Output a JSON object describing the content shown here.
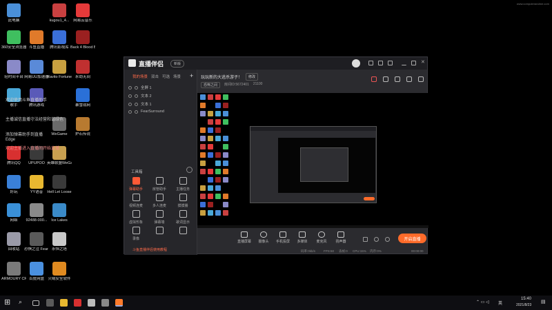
{
  "desktop": {
    "corner_text": "www.computerandme.com",
    "icons": [
      {
        "label": "此电脑",
        "color": "#4a8fd8"
      },
      {
        "label": "kugou1_4...",
        "color": "#c94040"
      },
      {
        "label": "网易云音乐",
        "color": "#e53a3a"
      },
      {
        "label": "360安全浏览器",
        "color": "#3fbf5f"
      },
      {
        "label": "斗鱼直播",
        "color": "#e07a2a"
      },
      {
        "label": "腾讯影视库",
        "color": "#3a6fd8"
      },
      {
        "label": "Back 4 Blood Beta",
        "color": "#9a2020"
      },
      {
        "label": "轻时间平台",
        "color": "#8a8ac8"
      },
      {
        "label": "网易UU加速器",
        "color": "#5a8ad8"
      },
      {
        "label": "Ravito Fortune",
        "color": "#c8a040"
      },
      {
        "label": "永劫无间",
        "color": "#c03030"
      },
      {
        "label": "歌手",
        "color": "#4aa8d8"
      },
      {
        "label": "腾讯游戏",
        "color": "#5a5ab8"
      },
      {
        "label": "暴雪战网",
        "color": "#2a70d8"
      },
      {
        "label": "WeGame",
        "color": "#6a6a6a"
      },
      {
        "label": "炉石传说",
        "color": "#b87a30"
      },
      {
        "label": "腾讯QQ",
        "color": "#d83030"
      },
      {
        "label": "UPUPOO",
        "color": "#3a3a3a"
      },
      {
        "label": "英雄联盟WeGame版",
        "color": "#c8a050"
      },
      {
        "label": "好玩",
        "color": "#3a80d8"
      },
      {
        "label": "YY语音",
        "color": "#e8b830"
      },
      {
        "label": "Hell Let Loose",
        "color": "#3a3a3a"
      },
      {
        "label": "网络",
        "color": "#3a90d8"
      },
      {
        "label": "92488-000...",
        "color": "#8a8a8a"
      },
      {
        "label": "Ice Lakes",
        "color": "#3a8ac8"
      },
      {
        "label": "回收站",
        "color": "#9a9aa8"
      },
      {
        "label": "恐惧之泣 Fear sur...",
        "color": "#5a5a5a"
      },
      {
        "label": "永恒之塔",
        "color": "#c8c8c8"
      },
      {
        "label": "ARMOURY CRATE",
        "color": "#7a7a7a"
      },
      {
        "label": "百度网盘",
        "color": "#4a90e0"
      },
      {
        "label": "火绒安全软件",
        "color": "#e08a20"
      }
    ],
    "overlay_lines": [
      "欢迎使用斗鱼直播助手",
      "主播诚信直播守法经营和谐绿色",
      "添加弹幕助手到直播",
      "Edge",
      "欢迎主播进入直播间开始直播"
    ]
  },
  "app": {
    "title": "直播伴侣",
    "version": "新版",
    "window_controls": [
      "minimize-icon",
      "maximize-icon",
      "close-icon"
    ],
    "sidebar": {
      "tabs": [
        "我的场景",
        "双击",
        "可选",
        "场景"
      ],
      "add": "+",
      "scenes": [
        "全屏 1",
        "文本 2",
        "文本 1",
        "FearSurround"
      ],
      "toolbox_title": "工具箱",
      "tools": [
        {
          "label": "弹幕助手",
          "hot": true
        },
        {
          "label": "房管助手",
          "hot": false
        },
        {
          "label": "主播任务",
          "hot": false
        },
        {
          "label": "视频连麦",
          "hot": false
        },
        {
          "label": "多人连麦",
          "hot": false
        },
        {
          "label": "摸摸播",
          "hot": false
        },
        {
          "label": "虚拟形象",
          "hot": false
        },
        {
          "label": "弹幕墙",
          "hot": false
        },
        {
          "label": "歌词显示",
          "hot": false
        },
        {
          "label": "录像",
          "hot": false
        },
        {
          "label": "",
          "hot": false
        },
        {
          "label": "",
          "hot": false
        }
      ],
      "bottom_note": "斗鱼直播伴侣使用教程"
    },
    "room": {
      "title": "玩玩新的大逃杀游子！",
      "edit": "修改",
      "category": "恐怖之间",
      "room_id": "房间ID:5672401",
      "hot": "21100"
    },
    "controls": [
      {
        "label": "直播屏幕"
      },
      {
        "label": "摄像头"
      },
      {
        "label": "手机投屏"
      },
      {
        "label": "多媒体"
      },
      {
        "label": "麦克风"
      },
      {
        "label": "扬声器"
      }
    ],
    "live_button": "开启直播",
    "status": {
      "rate": "码率:0kb/s",
      "fps": "FPS:60",
      "loss": "丢帧:0",
      "cpu": "CPU:15%",
      "mem": "内存:0%",
      "time": "00:00:00"
    }
  },
  "taskbar": {
    "time": "15:40",
    "date": "2021/8/23",
    "lang": "英"
  }
}
